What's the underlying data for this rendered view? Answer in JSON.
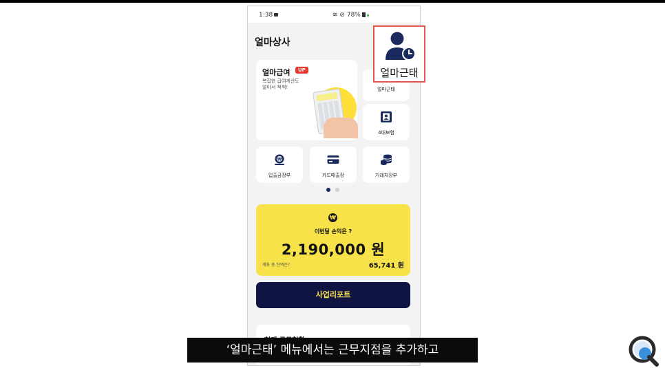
{
  "status_bar": {
    "time": "1:38",
    "battery": "78%"
  },
  "header": {
    "company": "얼마상사"
  },
  "salary_card": {
    "title": "얼마급여",
    "badge": "UP",
    "desc": "복잡한 급여계산도\n알아서 척척!"
  },
  "menu": {
    "attendance": "얼마근태",
    "insurance": "4대보험",
    "cash_ledger": "입출금장부",
    "card_sales": "카드매출장",
    "client_ledger": "거래처장부"
  },
  "pager": {
    "active": 1,
    "total": 2
  },
  "profit": {
    "currency_symbol": "₩",
    "question": "이번달 손익은 ?",
    "amount": "2,190,000 원",
    "balance_label": "계좌 총 잔액은?",
    "balance_value": "65,741 원"
  },
  "report_button": "사업리포트",
  "work_status": {
    "title": "현재 근무현황"
  },
  "callout": {
    "label": "얼마근태"
  },
  "subtitle": "‘얼마근태’ 메뉴에서는 근무지점을 추가하고",
  "colors": {
    "accent_yellow": "#f7e24a",
    "navy": "#0f1442",
    "badge_red": "#e8352e",
    "callout_border": "#e0574f"
  },
  "icons": [
    "camera-icon",
    "wifi-icon",
    "dnd-icon",
    "battery-icon",
    "user-clock-icon",
    "id-card-icon",
    "won-coin-icon",
    "credit-card-icon",
    "coins-stack-icon",
    "search-magnifier-icon"
  ]
}
